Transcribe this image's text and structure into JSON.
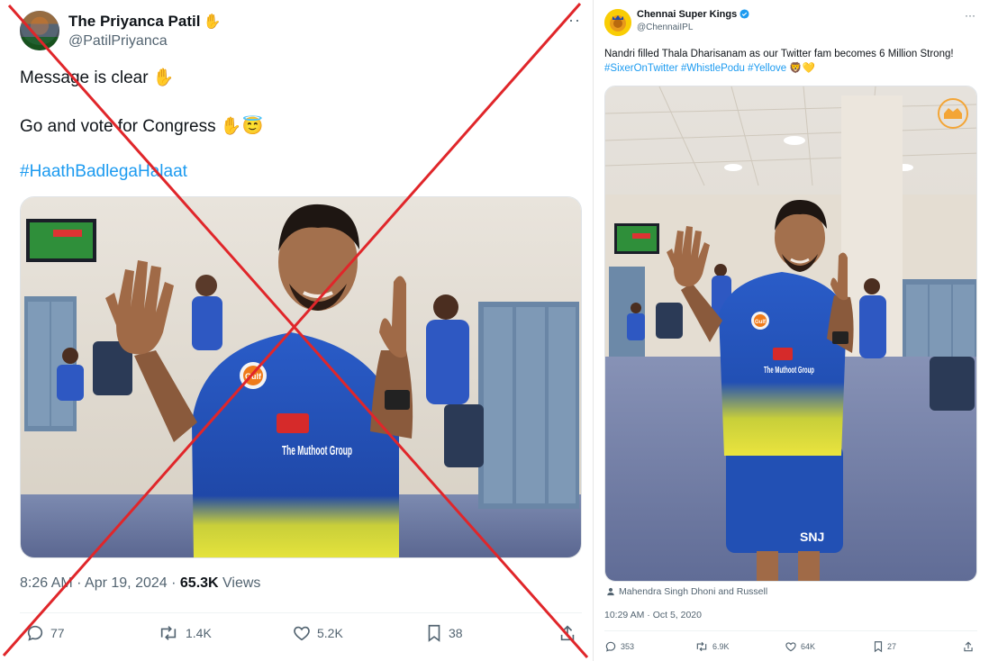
{
  "left_tweet": {
    "display_name": "The Priyanca Patil",
    "name_emoji": "✋",
    "handle": "@PatilPriyanca",
    "more": "···",
    "line1": "Message is clear ✋",
    "line2": "Go and vote for Congress ✋😇",
    "hashtag": "#HaathBadlegaHalaat",
    "time": "8:26 AM · Apr 19, 2024 · ",
    "views_count": "65.3K",
    "views_label": " Views",
    "stats": {
      "replies": "77",
      "reposts": "1.4K",
      "likes": "5.2K",
      "bookmarks": "38"
    },
    "jersey_sponsor": "The Muthoot Group",
    "jersey_badge": "Gulf"
  },
  "right_tweet": {
    "display_name": "Chennai Super Kings",
    "handle": "@ChennaiIPL",
    "more": "···",
    "text_plain": "Nandri filled Thala Dharisanam as our Twitter fam becomes 6 Million Strong! ",
    "tags": "#SixerOnTwitter #WhistlePodu #Yellove",
    "text_emoji": " 🦁💛",
    "tagged_people": "Mahendra Singh Dhoni and Russell",
    "time": "10:29 AM · Oct 5, 2020",
    "stats": {
      "replies": "353",
      "reposts": "6.9K",
      "likes": "64K",
      "bookmarks": "27"
    },
    "jersey_sponsor": "The Muthoot Group",
    "jersey_badge": "Gulf",
    "shorts_text": "SNJ"
  },
  "colors": {
    "link": "#1d9bf0",
    "secondary": "#536471",
    "cross": "#e0262a",
    "jersey": "#2350b8",
    "csk_yellow": "#f9cd05"
  }
}
